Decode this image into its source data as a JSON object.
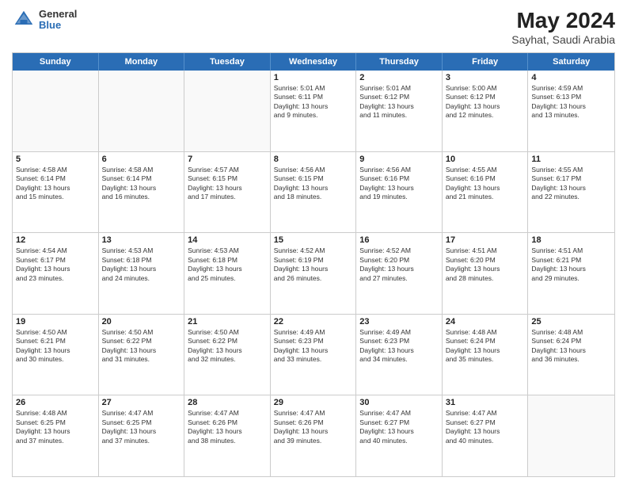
{
  "header": {
    "logo": {
      "general": "General",
      "blue": "Blue"
    },
    "title": "May 2024",
    "location": "Sayhat, Saudi Arabia"
  },
  "days_of_week": [
    "Sunday",
    "Monday",
    "Tuesday",
    "Wednesday",
    "Thursday",
    "Friday",
    "Saturday"
  ],
  "weeks": [
    [
      {
        "day": "",
        "info": ""
      },
      {
        "day": "",
        "info": ""
      },
      {
        "day": "",
        "info": ""
      },
      {
        "day": "1",
        "info": "Sunrise: 5:01 AM\nSunset: 6:11 PM\nDaylight: 13 hours\nand 9 minutes."
      },
      {
        "day": "2",
        "info": "Sunrise: 5:01 AM\nSunset: 6:12 PM\nDaylight: 13 hours\nand 11 minutes."
      },
      {
        "day": "3",
        "info": "Sunrise: 5:00 AM\nSunset: 6:12 PM\nDaylight: 13 hours\nand 12 minutes."
      },
      {
        "day": "4",
        "info": "Sunrise: 4:59 AM\nSunset: 6:13 PM\nDaylight: 13 hours\nand 13 minutes."
      }
    ],
    [
      {
        "day": "5",
        "info": "Sunrise: 4:58 AM\nSunset: 6:14 PM\nDaylight: 13 hours\nand 15 minutes."
      },
      {
        "day": "6",
        "info": "Sunrise: 4:58 AM\nSunset: 6:14 PM\nDaylight: 13 hours\nand 16 minutes."
      },
      {
        "day": "7",
        "info": "Sunrise: 4:57 AM\nSunset: 6:15 PM\nDaylight: 13 hours\nand 17 minutes."
      },
      {
        "day": "8",
        "info": "Sunrise: 4:56 AM\nSunset: 6:15 PM\nDaylight: 13 hours\nand 18 minutes."
      },
      {
        "day": "9",
        "info": "Sunrise: 4:56 AM\nSunset: 6:16 PM\nDaylight: 13 hours\nand 19 minutes."
      },
      {
        "day": "10",
        "info": "Sunrise: 4:55 AM\nSunset: 6:16 PM\nDaylight: 13 hours\nand 21 minutes."
      },
      {
        "day": "11",
        "info": "Sunrise: 4:55 AM\nSunset: 6:17 PM\nDaylight: 13 hours\nand 22 minutes."
      }
    ],
    [
      {
        "day": "12",
        "info": "Sunrise: 4:54 AM\nSunset: 6:17 PM\nDaylight: 13 hours\nand 23 minutes."
      },
      {
        "day": "13",
        "info": "Sunrise: 4:53 AM\nSunset: 6:18 PM\nDaylight: 13 hours\nand 24 minutes."
      },
      {
        "day": "14",
        "info": "Sunrise: 4:53 AM\nSunset: 6:18 PM\nDaylight: 13 hours\nand 25 minutes."
      },
      {
        "day": "15",
        "info": "Sunrise: 4:52 AM\nSunset: 6:19 PM\nDaylight: 13 hours\nand 26 minutes."
      },
      {
        "day": "16",
        "info": "Sunrise: 4:52 AM\nSunset: 6:20 PM\nDaylight: 13 hours\nand 27 minutes."
      },
      {
        "day": "17",
        "info": "Sunrise: 4:51 AM\nSunset: 6:20 PM\nDaylight: 13 hours\nand 28 minutes."
      },
      {
        "day": "18",
        "info": "Sunrise: 4:51 AM\nSunset: 6:21 PM\nDaylight: 13 hours\nand 29 minutes."
      }
    ],
    [
      {
        "day": "19",
        "info": "Sunrise: 4:50 AM\nSunset: 6:21 PM\nDaylight: 13 hours\nand 30 minutes."
      },
      {
        "day": "20",
        "info": "Sunrise: 4:50 AM\nSunset: 6:22 PM\nDaylight: 13 hours\nand 31 minutes."
      },
      {
        "day": "21",
        "info": "Sunrise: 4:50 AM\nSunset: 6:22 PM\nDaylight: 13 hours\nand 32 minutes."
      },
      {
        "day": "22",
        "info": "Sunrise: 4:49 AM\nSunset: 6:23 PM\nDaylight: 13 hours\nand 33 minutes."
      },
      {
        "day": "23",
        "info": "Sunrise: 4:49 AM\nSunset: 6:23 PM\nDaylight: 13 hours\nand 34 minutes."
      },
      {
        "day": "24",
        "info": "Sunrise: 4:48 AM\nSunset: 6:24 PM\nDaylight: 13 hours\nand 35 minutes."
      },
      {
        "day": "25",
        "info": "Sunrise: 4:48 AM\nSunset: 6:24 PM\nDaylight: 13 hours\nand 36 minutes."
      }
    ],
    [
      {
        "day": "26",
        "info": "Sunrise: 4:48 AM\nSunset: 6:25 PM\nDaylight: 13 hours\nand 37 minutes."
      },
      {
        "day": "27",
        "info": "Sunrise: 4:47 AM\nSunset: 6:25 PM\nDaylight: 13 hours\nand 37 minutes."
      },
      {
        "day": "28",
        "info": "Sunrise: 4:47 AM\nSunset: 6:26 PM\nDaylight: 13 hours\nand 38 minutes."
      },
      {
        "day": "29",
        "info": "Sunrise: 4:47 AM\nSunset: 6:26 PM\nDaylight: 13 hours\nand 39 minutes."
      },
      {
        "day": "30",
        "info": "Sunrise: 4:47 AM\nSunset: 6:27 PM\nDaylight: 13 hours\nand 40 minutes."
      },
      {
        "day": "31",
        "info": "Sunrise: 4:47 AM\nSunset: 6:27 PM\nDaylight: 13 hours\nand 40 minutes."
      },
      {
        "day": "",
        "info": ""
      }
    ]
  ]
}
